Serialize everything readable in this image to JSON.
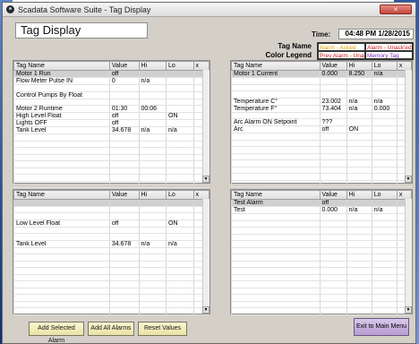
{
  "window": {
    "title": "Scadata Software Suite - Tag Display",
    "close_label": ""
  },
  "page_title": "Tag Display",
  "time": {
    "label": "Time:",
    "value": "04:48 PM 1/28/2015"
  },
  "legend": {
    "title_line1": "Tag Name",
    "title_line2": "Color Legend",
    "cells": [
      {
        "text": "Alarm - Acked",
        "color": "#e8a000"
      },
      {
        "text": "Alarm - Unack'ed",
        "color": "#d01818"
      },
      {
        "text": "Prev Alarm - Unack'ed",
        "color": "#d01818"
      },
      {
        "text": "Memory Tag",
        "color": "#7a2ec0"
      }
    ]
  },
  "headers": {
    "tag": "Tag Name",
    "value": "Value",
    "hi": "Hi",
    "lo": "Lo"
  },
  "panels": {
    "top_left": [
      {
        "name": "Motor 1 Run",
        "value": "off",
        "hi": "",
        "lo": "",
        "cls": "",
        "sel": true
      },
      {
        "name": "Flow Meter Pulse IN",
        "value": "0",
        "hi": "n/a",
        "lo": "",
        "cls": ""
      },
      {
        "name": "",
        "value": "",
        "hi": "",
        "lo": "",
        "cls": ""
      },
      {
        "name": "Control Pumps By Float",
        "value": "",
        "hi": "",
        "lo": "",
        "cls": "c-grey"
      },
      {
        "name": "",
        "value": "",
        "hi": "",
        "lo": "",
        "cls": ""
      },
      {
        "name": "Motor 2 Runtime",
        "value": "01:30",
        "hi": "00:06",
        "lo": "",
        "cls": ""
      },
      {
        "name": "High Level Float",
        "value": "off",
        "hi": "",
        "lo": "ON",
        "cls": ""
      },
      {
        "name": "Lights OFF",
        "value": "off",
        "hi": "",
        "lo": "",
        "cls": "c-blue"
      },
      {
        "name": "Tank Level",
        "value": "34.678",
        "hi": "n/a",
        "lo": "n/a",
        "cls": ""
      }
    ],
    "top_right": [
      {
        "name": "Motor 1 Current",
        "value": "0.000",
        "hi": "8.250",
        "lo": "n/a",
        "cls": "",
        "sel": true
      },
      {
        "name": "",
        "value": "",
        "hi": "",
        "lo": "",
        "cls": ""
      },
      {
        "name": "",
        "value": "",
        "hi": "",
        "lo": "",
        "cls": ""
      },
      {
        "name": "",
        "value": "",
        "hi": "",
        "lo": "",
        "cls": ""
      },
      {
        "name": "Temperature C°",
        "value": "23.002",
        "hi": "n/a",
        "lo": "n/a",
        "cls": ""
      },
      {
        "name": "Temperature F°",
        "value": "73.404",
        "hi": "n/a",
        "lo": "0.000",
        "cls": ""
      },
      {
        "name": "",
        "value": "",
        "hi": "",
        "lo": "",
        "cls": ""
      },
      {
        "name": "Arc Alarm ON Setpoint",
        "value": "???",
        "hi": "",
        "lo": "",
        "cls": "c-blue"
      },
      {
        "name": "Arc",
        "value": "off",
        "hi": "ON",
        "lo": "",
        "cls": ""
      }
    ],
    "bottom_left": [
      {
        "name": "",
        "value": "",
        "hi": "",
        "lo": "",
        "cls": "",
        "sel": true
      },
      {
        "name": "",
        "value": "",
        "hi": "",
        "lo": "",
        "cls": ""
      },
      {
        "name": "",
        "value": "",
        "hi": "",
        "lo": "",
        "cls": ""
      },
      {
        "name": "Low Level Float",
        "value": "off",
        "hi": "",
        "lo": "ON",
        "cls": ""
      },
      {
        "name": "",
        "value": "",
        "hi": "",
        "lo": "",
        "cls": ""
      },
      {
        "name": "",
        "value": "",
        "hi": "",
        "lo": "",
        "cls": ""
      },
      {
        "name": "Tank Level",
        "value": "34.678",
        "hi": "n/a",
        "lo": "n/a",
        "cls": ""
      }
    ],
    "bottom_right": [
      {
        "name": "Test Alarm",
        "value": "off",
        "hi": "",
        "lo": "",
        "cls": "c-blue",
        "sel": true
      },
      {
        "name": "Test",
        "value": "0.000",
        "hi": "n/a",
        "lo": "n/a",
        "cls": ""
      }
    ]
  },
  "buttons": {
    "add_selected": "Add Selected Alarm",
    "add_all": "Add All Alarms",
    "reset": "Reset Values",
    "exit": "Exit to Main Menu"
  },
  "colors": {
    "accent_blue": "#2050d0",
    "grey_tag": "#9aa8b8",
    "button_yellow": "#e9e2a4",
    "button_purple": "#b79bd1"
  }
}
